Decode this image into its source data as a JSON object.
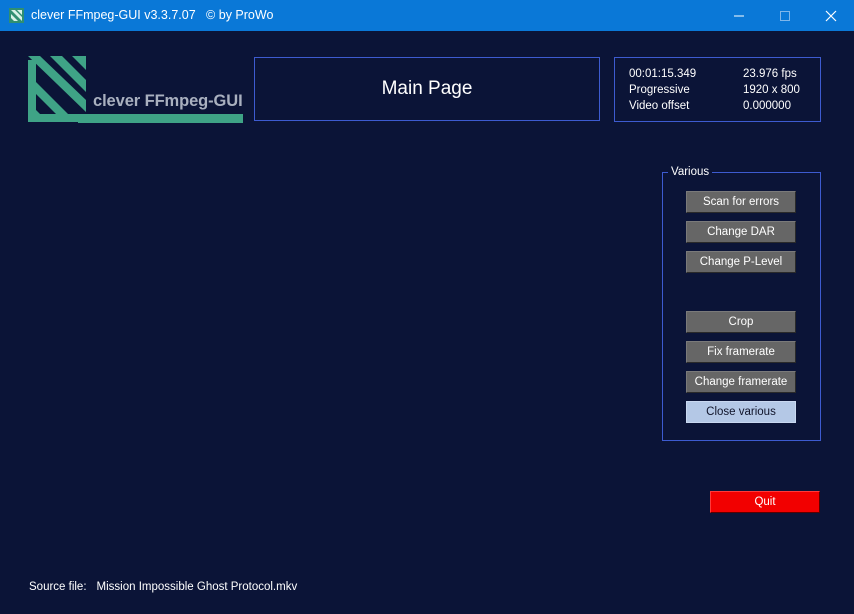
{
  "window": {
    "title": "clever FFmpeg-GUI v3.3.7.07   © by ProWo"
  },
  "logo": {
    "text": "clever FFmpeg-GUI"
  },
  "main": {
    "title": "Main Page"
  },
  "info": {
    "time": "00:01:15.349",
    "fps": "23.976 fps",
    "scan": "Progressive",
    "resolution": "1920 x 800",
    "offset_label": "Video offset",
    "offset_value": "0.000000"
  },
  "various": {
    "legend": "Various",
    "scan_errors": "Scan for errors",
    "change_dar": "Change DAR",
    "change_plevel": "Change P-Level",
    "crop": "Crop",
    "fix_framerate": "Fix framerate",
    "change_framerate": "Change framerate",
    "close_various": "Close various"
  },
  "quit": "Quit",
  "source": {
    "label": "Source file:",
    "value": "Mission Impossible Ghost Protocol.mkv"
  },
  "colors": {
    "background": "#0b1437",
    "titlebar": "#0a78d7",
    "frame_border": "#3d5bd0",
    "button": "#666666",
    "button_active": "#b4c8e6",
    "quit": "#f20000",
    "logo_green": "#3fa386"
  },
  "icons": {
    "app": "ffmpeg-logo-icon",
    "minimize": "minimize-icon",
    "maximize": "maximize-icon",
    "close": "close-icon"
  }
}
